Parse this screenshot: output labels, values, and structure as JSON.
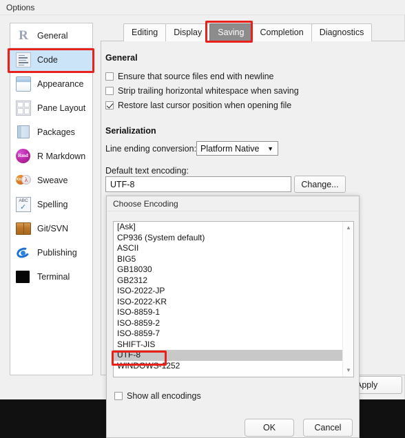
{
  "window": {
    "title": "Options"
  },
  "sidebar": {
    "items": [
      {
        "label": "General",
        "icon": "r-logo-icon",
        "selected": false
      },
      {
        "label": "Code",
        "icon": "code-document-icon",
        "selected": true
      },
      {
        "label": "Appearance",
        "icon": "paint-bucket-icon",
        "selected": false
      },
      {
        "label": "Pane Layout",
        "icon": "grid-panes-icon",
        "selected": false
      },
      {
        "label": "Packages",
        "icon": "book-icon",
        "selected": false
      },
      {
        "label": "R Markdown",
        "icon": "rmd-badge-icon",
        "selected": false
      },
      {
        "label": "Sweave",
        "icon": "sweave-pdf-icon",
        "selected": false
      },
      {
        "label": "Spelling",
        "icon": "abc-check-icon",
        "selected": false
      },
      {
        "label": "Git/SVN",
        "icon": "box-icon",
        "selected": false
      },
      {
        "label": "Publishing",
        "icon": "publish-orbit-icon",
        "selected": false
      },
      {
        "label": "Terminal",
        "icon": "terminal-icon",
        "selected": false
      }
    ]
  },
  "tabs": [
    {
      "label": "Editing",
      "active": false
    },
    {
      "label": "Display",
      "active": false
    },
    {
      "label": "Saving",
      "active": true
    },
    {
      "label": "Completion",
      "active": false
    },
    {
      "label": "Diagnostics",
      "active": false
    }
  ],
  "saving_panel": {
    "general_heading": "General",
    "checkboxes": [
      {
        "label": "Ensure that source files end with newline",
        "checked": false
      },
      {
        "label": "Strip trailing horizontal whitespace when saving",
        "checked": false
      },
      {
        "label": "Restore last cursor position when opening file",
        "checked": true
      }
    ],
    "serialization_heading": "Serialization",
    "line_ending_label": "Line ending conversion:",
    "line_ending_value": "Platform Native",
    "default_encoding_label": "Default text encoding:",
    "default_encoding_value": "UTF-8",
    "change_button": "Change..."
  },
  "options_buttons": {
    "apply": "Apply"
  },
  "encoding_dialog": {
    "title": "Choose Encoding",
    "encodings": [
      "[Ask]",
      "CP936 (System default)",
      "ASCII",
      "BIG5",
      "GB18030",
      "GB2312",
      "ISO-2022-JP",
      "ISO-2022-KR",
      "ISO-8859-1",
      "ISO-8859-2",
      "ISO-8859-7",
      "SHIFT-JIS",
      "UTF-8",
      "WINDOWS-1252"
    ],
    "selected_encoding": "UTF-8",
    "show_all_label": "Show all encodings",
    "show_all_checked": false,
    "ok_button": "OK",
    "cancel_button": "Cancel",
    "scroll_up_icon": "▲",
    "scroll_down_icon": "▼"
  },
  "annotations": {
    "accent_color": "#e8211a",
    "highlighted": [
      "Code",
      "Saving",
      "UTF-8"
    ]
  }
}
